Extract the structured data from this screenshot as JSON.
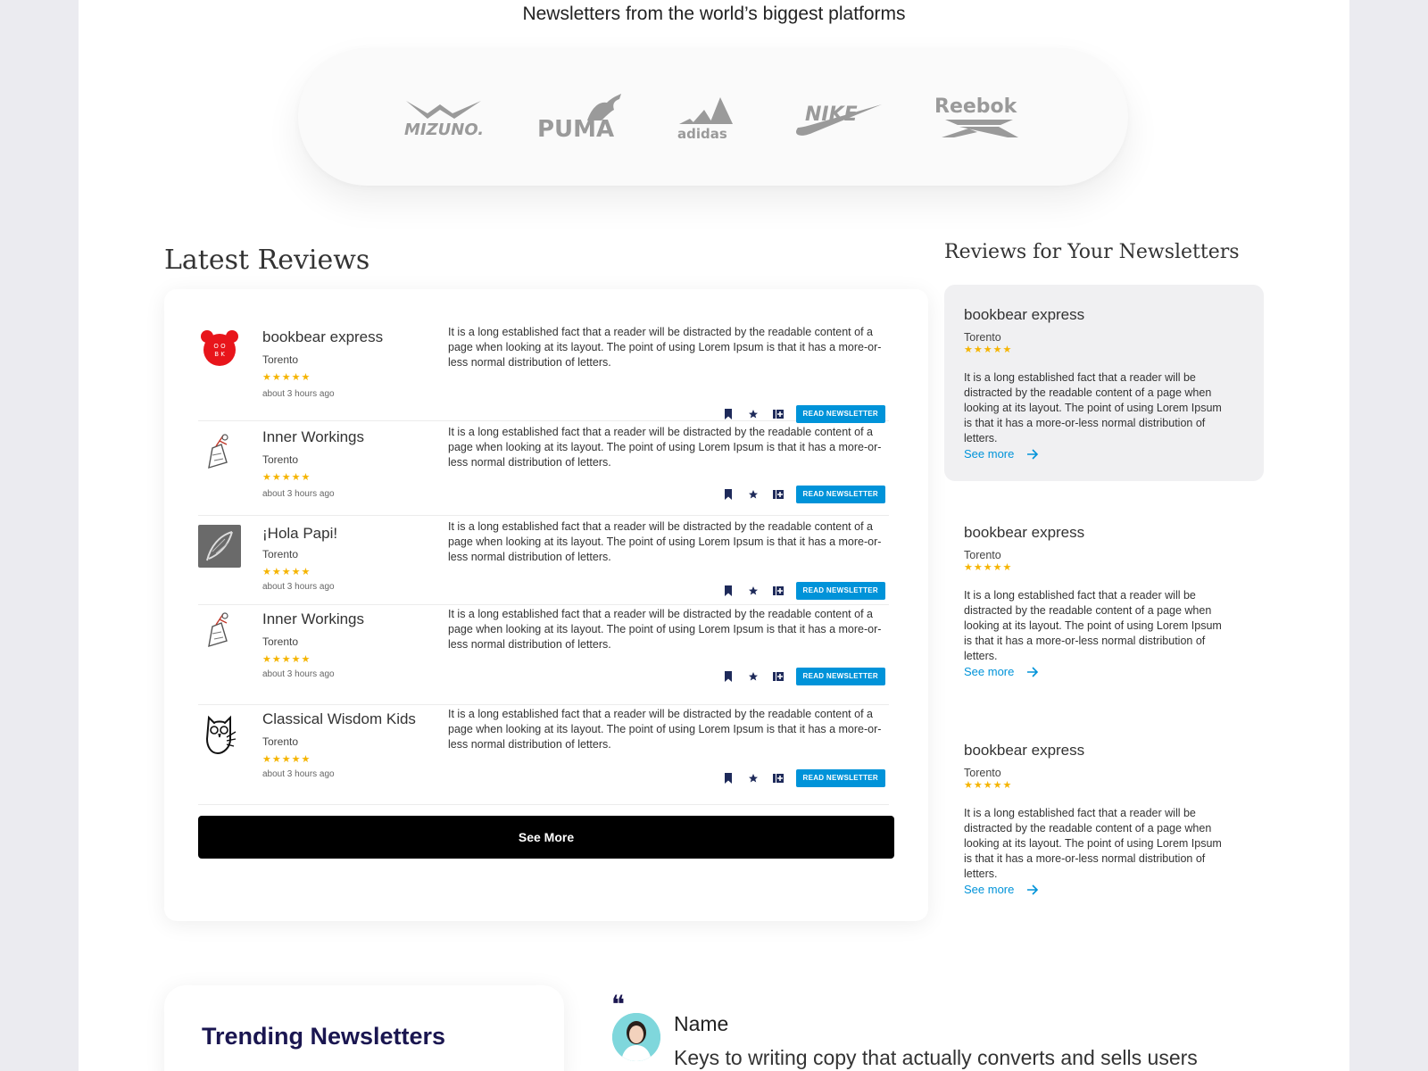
{
  "platforms": {
    "title": "Newsletters from the world’s biggest platforms",
    "logos": [
      "mizuno-logo",
      "puma-logo",
      "adidas-logo",
      "nike-logo",
      "reebok-logo"
    ]
  },
  "latest": {
    "title": "Latest Reviews",
    "see_more_label": "See More",
    "reviews": [
      {
        "name": "bookbear express",
        "city": "Torento",
        "rating": 5,
        "stars": "★★★★★",
        "time": "about 3 hours ago",
        "avatar": "bookbear-logo",
        "body": "It is a long established fact that a reader will be distracted by the readable content of a page when looking at its layout. The point of using Lorem Ipsum is that it has a more-or-less normal distribution of letters.",
        "button": "READ NEWSLETTER"
      },
      {
        "name": "Inner Workings",
        "city": "Torento",
        "rating": 5,
        "stars": "★★★★★",
        "time": "about 3 hours ago",
        "avatar": "inner-workings-logo",
        "body": "It is a long established fact that a reader will be distracted by the readable content of a page when looking at its layout. The point of using Lorem Ipsum is that it has a more-or-less normal distribution of letters.",
        "button": "READ NEWSLETTER"
      },
      {
        "name": "¡Hola Papi!",
        "city": "Torento",
        "rating": 5,
        "stars": "★★★★★",
        "time": "about 3 hours ago",
        "avatar": "hola-papi-logo",
        "body": "It is a long established fact that a reader will be distracted by the readable content of a page when looking at its layout. The point of using Lorem Ipsum is that it has a more-or-less normal distribution of letters.",
        "button": "READ NEWSLETTER"
      },
      {
        "name": "Inner Workings",
        "city": "Torento",
        "rating": 5,
        "stars": "★★★★★",
        "time": "about 3 hours ago",
        "avatar": "inner-workings-logo",
        "body": "It is a long established fact that a reader will be distracted by the readable content of a page when looking at its layout. The point of using Lorem Ipsum is that it has a more-or-less normal distribution of letters.",
        "button": "READ NEWSLETTER"
      },
      {
        "name": "Classical Wisdom Kids",
        "city": "Torento",
        "rating": 5,
        "stars": "★★★★★",
        "time": "about 3 hours ago",
        "avatar": "owl-logo",
        "body": "It is a long established fact that a reader will be distracted by the readable content of a page when looking at its layout. The point of using Lorem Ipsum is that it has a more-or-less normal distribution of letters.",
        "button": "READ NEWSLETTER"
      }
    ]
  },
  "sidebar": {
    "title": "Reviews for Your Newsletters",
    "cards": [
      {
        "name": "bookbear express",
        "city": "Torento",
        "rating": 5,
        "stars": "★★★★★",
        "body": "It is a long established fact that a reader will be distracted by the readable content of a page when looking at its layout. The point of using Lorem Ipsum is that it has a more-or-less normal distribution of letters.",
        "link": "See more"
      },
      {
        "name": "bookbear express",
        "city": "Torento",
        "rating": 5,
        "stars": "★★★★★",
        "body": "It is a long established fact that a reader will be distracted by the readable content of a page when looking at its layout. The point of using Lorem Ipsum is that it has a more-or-less normal distribution of letters.",
        "link": "See more"
      },
      {
        "name": "bookbear express",
        "city": "Torento",
        "rating": 5,
        "stars": "★★★★★",
        "body": "It is a long established fact that a reader will be distracted by the readable content of a page when looking at its layout. The point of using Lorem Ipsum is that it has a more-or-less normal distribution of letters.",
        "link": "See more"
      }
    ]
  },
  "trending": {
    "title": "Trending Newsletters"
  },
  "testimonial": {
    "quote_mark": "❝",
    "name": "Name",
    "text": "Keys to writing copy that actually converts and sells users"
  },
  "colors": {
    "accent": "#0093d9",
    "star": "#f5b400",
    "navy": "#1a1650",
    "button_dark": "#000000"
  }
}
